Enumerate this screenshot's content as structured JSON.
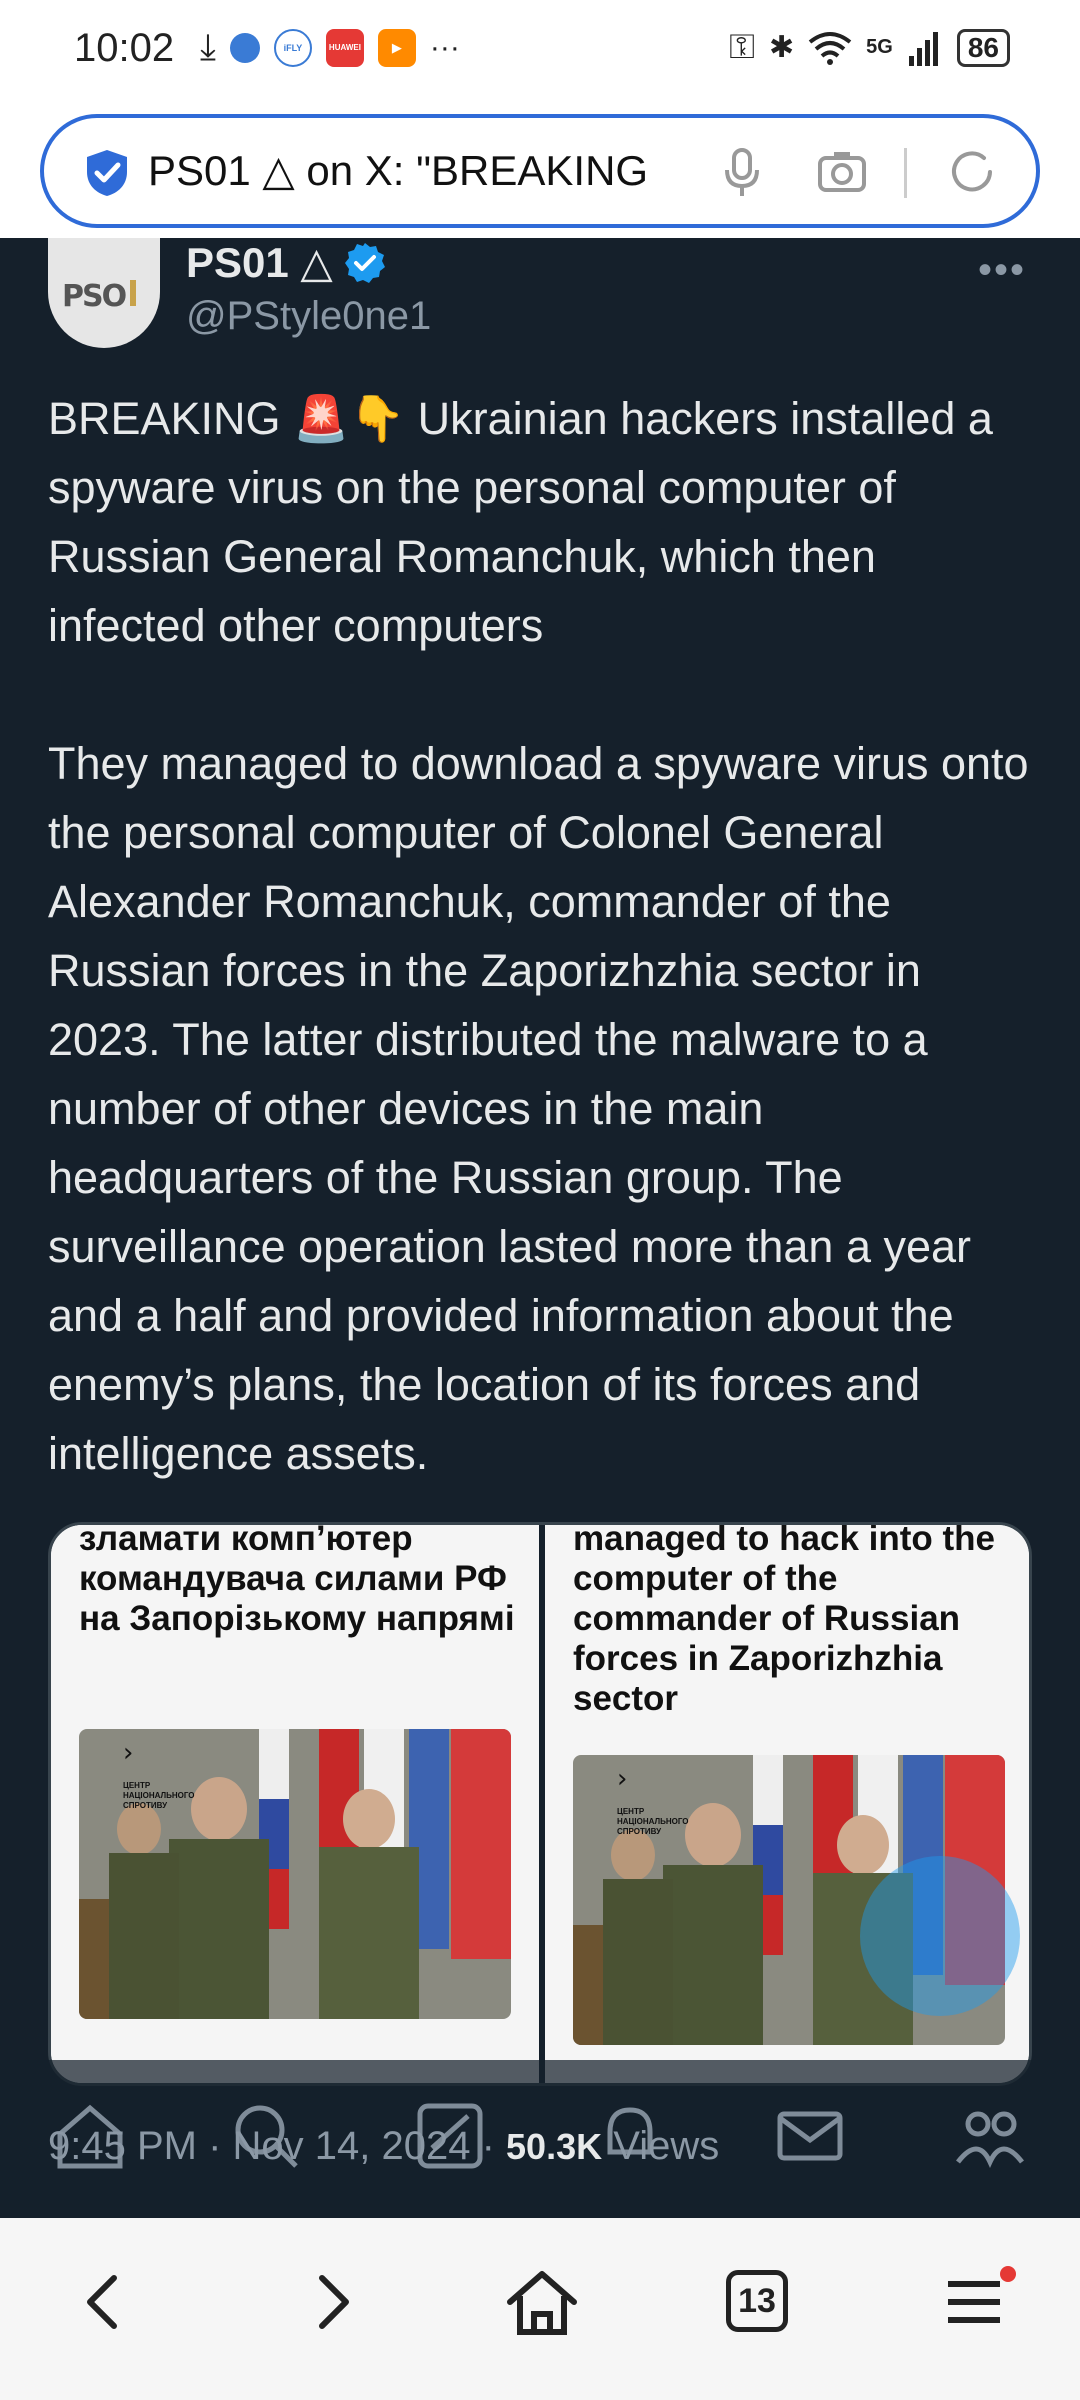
{
  "status_bar": {
    "time": "10:02",
    "battery": "86",
    "network": "5G"
  },
  "browser": {
    "url_text": "PS01 △ on X: \"BREAKING",
    "tab_count": "13"
  },
  "tweet": {
    "author_name": "PS01 △",
    "author_handle": "@PStyle0ne1",
    "body": "BREAKING 🚨👇 Ukrainian hackers installed a spyware virus on the personal computer of Russian General Romanchuk, which then infected other computers\n\nThey managed to download a spyware virus onto the personal computer of Colonel General Alexander Romanchuk, commander of the Russian forces in the Zaporizhzhia sector in 2023. The latter distributed the malware to a number of other devices in the main headquarters of the Russian group. The surveillance operation lasted more than a year and a half and provided information about the enemy’s plans, the location of its forces and intelligence assets.",
    "media": {
      "left_heading": "зламати комп’ютер командувача силами РФ на Запорізькому напрямі",
      "right_heading": "managed to hack into the computer of the commander of Russian forces in Zaporizhzhia sector",
      "photo_caption": "ЦЕНТР НАЦІОНАЛЬНОГО СПРОТИВУ"
    },
    "timestamp": "9:45 PM · Nov 14, 2024 ·",
    "views_count": "50.3K",
    "views_label": "Views"
  },
  "colors": {
    "background": "#15202b",
    "accent": "#1d9bf0",
    "url_border": "#2f6bd8"
  }
}
